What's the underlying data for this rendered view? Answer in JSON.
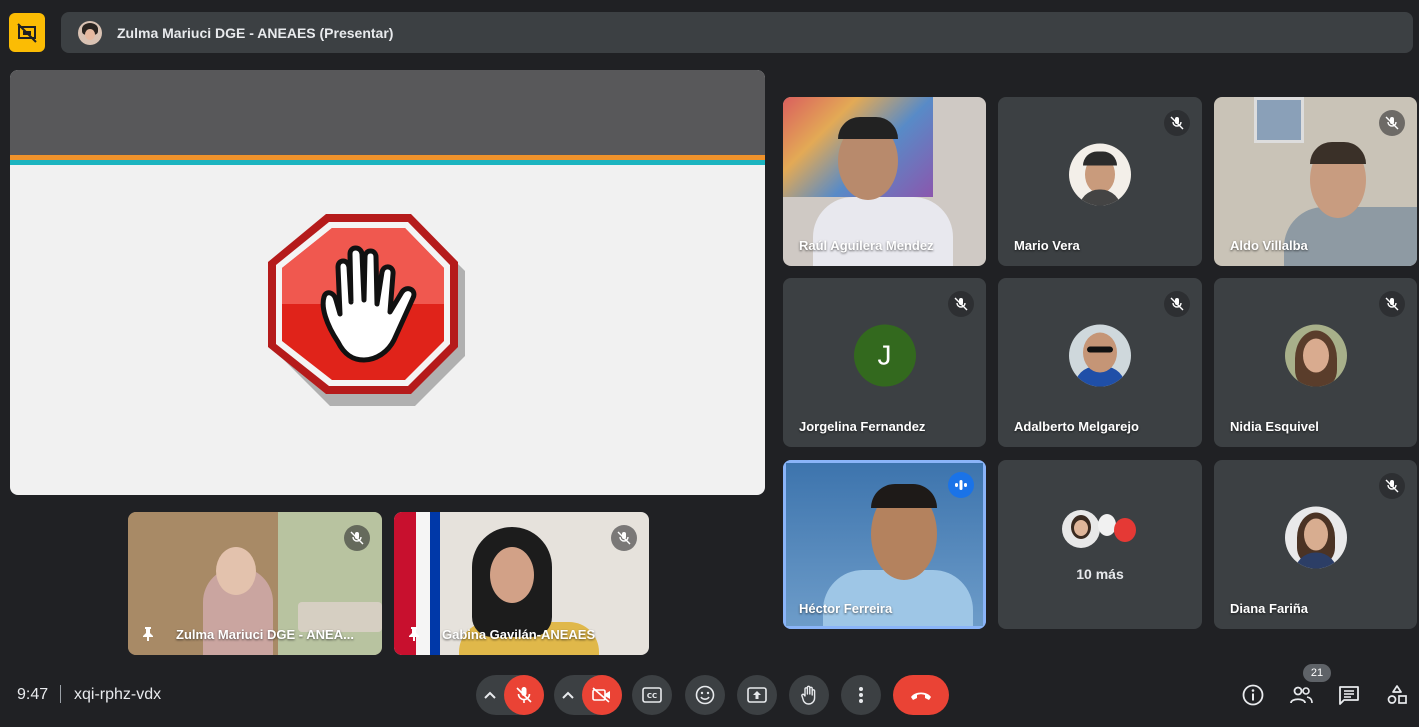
{
  "presenter_bar": {
    "text": "Zulma Mariuci DGE - ANEAES (Presentar)"
  },
  "participants": [
    {
      "name": "Raúl Aguilera Mendez"
    },
    {
      "name": "Mario Vera"
    },
    {
      "name": "Aldo Villalba"
    },
    {
      "name": "Jorgelina Fernandez",
      "initial": "J"
    },
    {
      "name": "Adalberto Melgarejo"
    },
    {
      "name": "Nidia Esquivel"
    },
    {
      "name": "Héctor Ferreira"
    },
    {
      "name": "Diana Fariña"
    }
  ],
  "more": {
    "label": "10 más"
  },
  "pinned": [
    {
      "name": "Zulma Mariuci DGE - ANEA..."
    },
    {
      "name": "Gabina Gavilán-ANEAES"
    }
  ],
  "footer": {
    "time": "9:47",
    "meeting_code": "xqi-rphz-vdx",
    "participant_count": "21"
  },
  "colors": {
    "present_button": "#fbbc04",
    "end_call": "#ea4335",
    "speaking_border": "#8ab4f8",
    "jorgelina_avatar": "#33691e"
  },
  "icons": [
    "present-stop-icon",
    "mic-off-icon",
    "camera-off-icon",
    "captions-icon",
    "emoji-icon",
    "present-icon",
    "raise-hand-icon",
    "more-options-icon",
    "end-call-icon",
    "info-icon",
    "people-icon",
    "chat-icon",
    "activities-icon"
  ]
}
